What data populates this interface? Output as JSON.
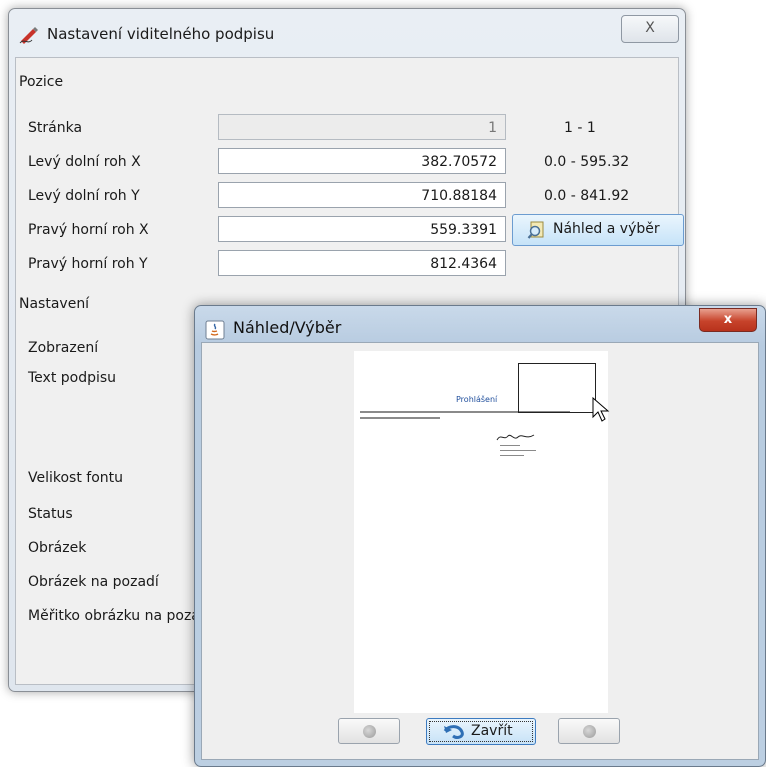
{
  "main_window": {
    "title": "Nastavení viditelného podpisu",
    "close_label": "X",
    "section_position": "Pozice",
    "section_settings": "Nastavení",
    "rows": [
      {
        "label": "Stránka",
        "value": "1",
        "range": "1 - 1"
      },
      {
        "label": "Levý dolní roh X",
        "value": "382.70572",
        "range": "0.0 - 595.32"
      },
      {
        "label": "Levý dolní roh Y",
        "value": "710.88184",
        "range": "0.0 - 841.92"
      },
      {
        "label": "Pravý horní roh X",
        "value": "559.3391",
        "range": ""
      },
      {
        "label": "Pravý horní roh Y",
        "value": "812.4364",
        "range": ""
      }
    ],
    "preview_button": "Náhled a výběr",
    "settings_labels": [
      "Zobrazení",
      "Text podpisu",
      "Velikost fontu",
      "Status",
      "Obrázek",
      "Obrázek na pozadí",
      "Měřitko obrázku na pozadí"
    ]
  },
  "preview_window": {
    "title": "Náhled/Výběr",
    "close_label": "x",
    "page_heading": "Prohlášení",
    "close_button": "Zavřít"
  },
  "colors": {
    "accent": "#c7e2f7",
    "close_red": "#c7432b",
    "heading_blue": "#1f4e9c"
  }
}
